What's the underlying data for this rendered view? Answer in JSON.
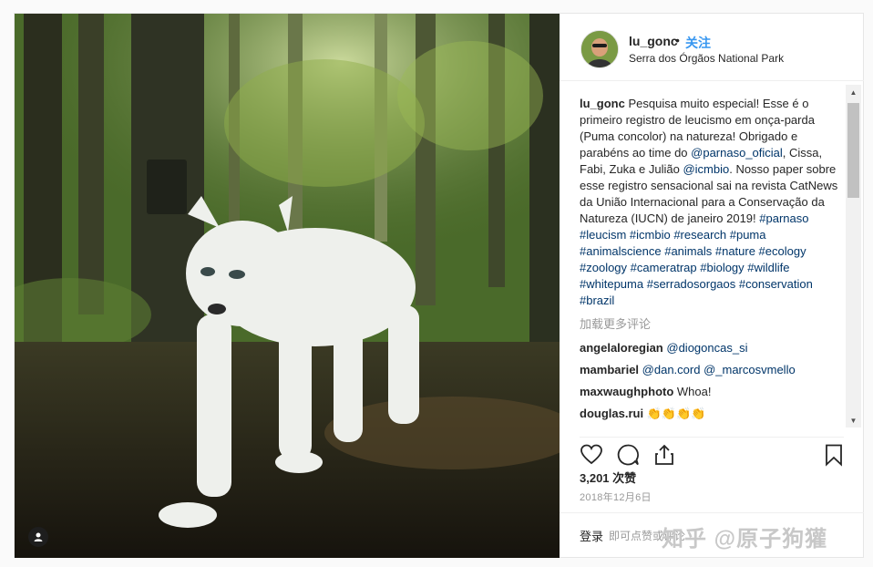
{
  "header": {
    "username": "lu_gonc",
    "separator": "•",
    "follow_label": "关注",
    "location": "Serra dos Órgãos National Park"
  },
  "caption": {
    "username": "lu_gonc",
    "text": " Pesquisa muito especial! Esse é o primeiro registro de leucismo em onça-parda (Puma concolor) na natureza! Obrigado e parabéns ao time do ",
    "mention": "@parnaso_oficial",
    "text2": ", Cissa, Fabi, Zuka e Julião ",
    "mention2": "@icmbio",
    "text3": ". Nosso paper sobre esse registro sensacional sai na revista CatNews da União Internacional para a Conservação da Natureza (IUCN) de janeiro 2019! ",
    "hashtags": "#parnaso #leucism #icmbio #research #puma #animalscience #animals #nature #ecology #zoology #cameratrap #biology #wildlife #whitepuma #serradosorgaos #conservation #brazil"
  },
  "load_more": "加载更多评论",
  "comments": [
    {
      "user": "angelaloregian",
      "text": "@diogoncas_si"
    },
    {
      "user": "mambariel",
      "text": "@dan.cord @_marcosvmello"
    },
    {
      "user": "maxwaughphoto",
      "text": "Whoa!"
    },
    {
      "user": "douglas.rui",
      "text": "👏👏👏👏"
    }
  ],
  "likes": "3,201 次赞",
  "date": "2018年12月6日",
  "footer": {
    "login": "登录",
    "rest": "即可点赞或评论",
    "watermark": "知乎 @原子狗獾"
  },
  "icons": [
    "heart-icon",
    "comment-icon",
    "share-icon",
    "bookmark-icon",
    "user-tag-icon"
  ],
  "colors": {
    "link": "#3897f0",
    "hashtag": "#003569",
    "muted": "#999999"
  }
}
